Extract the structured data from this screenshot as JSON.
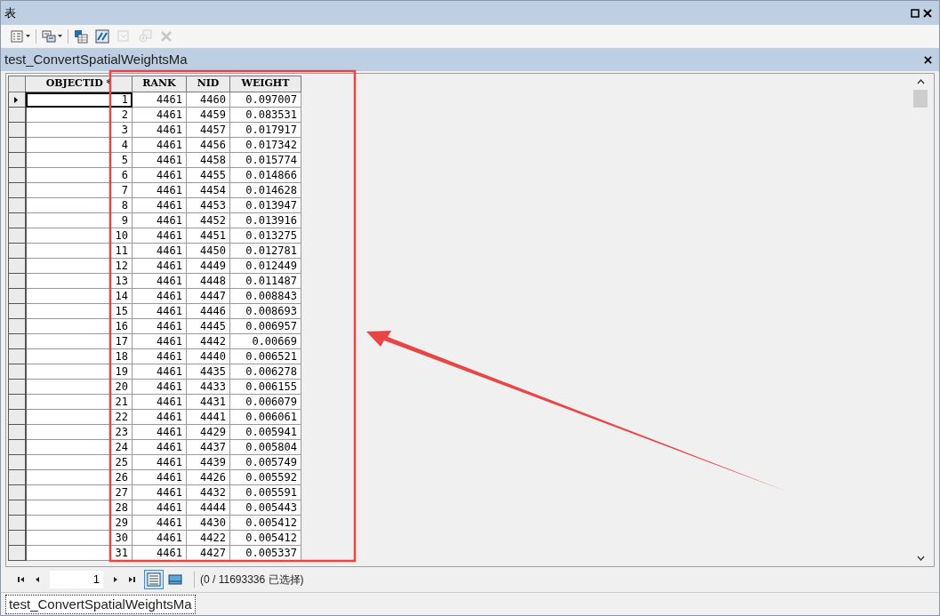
{
  "window": {
    "title": "表"
  },
  "toolbar": [
    {
      "kind": "table-options",
      "disabled": false
    },
    {
      "kind": "related-tables",
      "disabled": false
    },
    {
      "kind": "select-by-attributes",
      "disabled": false
    },
    {
      "kind": "switch-selection",
      "disabled": false
    },
    {
      "kind": "clear-selection",
      "disabled": true
    },
    {
      "kind": "zoom-selected",
      "disabled": true
    },
    {
      "kind": "delete",
      "disabled": true
    }
  ],
  "table_tab": {
    "title": "test_ConvertSpatialWeightsMa"
  },
  "table": {
    "columns": [
      "OBJECTID *",
      "RANK",
      "NID",
      "WEIGHT"
    ],
    "rows": [
      {
        "current": true,
        "cells": [
          "1",
          "4461",
          "4460",
          "0.097007"
        ]
      },
      {
        "current": false,
        "cells": [
          "2",
          "4461",
          "4459",
          "0.083531"
        ]
      },
      {
        "current": false,
        "cells": [
          "3",
          "4461",
          "4457",
          "0.017917"
        ]
      },
      {
        "current": false,
        "cells": [
          "4",
          "4461",
          "4456",
          "0.017342"
        ]
      },
      {
        "current": false,
        "cells": [
          "5",
          "4461",
          "4458",
          "0.015774"
        ]
      },
      {
        "current": false,
        "cells": [
          "6",
          "4461",
          "4455",
          "0.014866"
        ]
      },
      {
        "current": false,
        "cells": [
          "7",
          "4461",
          "4454",
          "0.014628"
        ]
      },
      {
        "current": false,
        "cells": [
          "8",
          "4461",
          "4453",
          "0.013947"
        ]
      },
      {
        "current": false,
        "cells": [
          "9",
          "4461",
          "4452",
          "0.013916"
        ]
      },
      {
        "current": false,
        "cells": [
          "10",
          "4461",
          "4451",
          "0.013275"
        ]
      },
      {
        "current": false,
        "cells": [
          "11",
          "4461",
          "4450",
          "0.012781"
        ]
      },
      {
        "current": false,
        "cells": [
          "12",
          "4461",
          "4449",
          "0.012449"
        ]
      },
      {
        "current": false,
        "cells": [
          "13",
          "4461",
          "4448",
          "0.011487"
        ]
      },
      {
        "current": false,
        "cells": [
          "14",
          "4461",
          "4447",
          "0.008843"
        ]
      },
      {
        "current": false,
        "cells": [
          "15",
          "4461",
          "4446",
          "0.008693"
        ]
      },
      {
        "current": false,
        "cells": [
          "16",
          "4461",
          "4445",
          "0.006957"
        ]
      },
      {
        "current": false,
        "cells": [
          "17",
          "4461",
          "4442",
          "0.00669"
        ]
      },
      {
        "current": false,
        "cells": [
          "18",
          "4461",
          "4440",
          "0.006521"
        ]
      },
      {
        "current": false,
        "cells": [
          "19",
          "4461",
          "4435",
          "0.006278"
        ]
      },
      {
        "current": false,
        "cells": [
          "20",
          "4461",
          "4433",
          "0.006155"
        ]
      },
      {
        "current": false,
        "cells": [
          "21",
          "4461",
          "4431",
          "0.006079"
        ]
      },
      {
        "current": false,
        "cells": [
          "22",
          "4461",
          "4441",
          "0.006061"
        ]
      },
      {
        "current": false,
        "cells": [
          "23",
          "4461",
          "4429",
          "0.005941"
        ]
      },
      {
        "current": false,
        "cells": [
          "24",
          "4461",
          "4437",
          "0.005804"
        ]
      },
      {
        "current": false,
        "cells": [
          "25",
          "4461",
          "4439",
          "0.005749"
        ]
      },
      {
        "current": false,
        "cells": [
          "26",
          "4461",
          "4426",
          "0.005592"
        ]
      },
      {
        "current": false,
        "cells": [
          "27",
          "4461",
          "4432",
          "0.005591"
        ]
      },
      {
        "current": false,
        "cells": [
          "28",
          "4461",
          "4444",
          "0.005443"
        ]
      },
      {
        "current": false,
        "cells": [
          "29",
          "4461",
          "4430",
          "0.005412"
        ]
      },
      {
        "current": false,
        "cells": [
          "30",
          "4461",
          "4422",
          "0.005412"
        ]
      },
      {
        "current": false,
        "cells": [
          "31",
          "4461",
          "4427",
          "0.005337"
        ]
      }
    ]
  },
  "navigation": {
    "page": "1",
    "views": [
      {
        "kind": "all-records",
        "selected": true
      },
      {
        "kind": "selected-records",
        "selected": false
      }
    ],
    "selection_count": "(0 / 11693336 已选择)"
  },
  "bottom_tabs": [
    {
      "label": "test_ConvertSpatialWeightsMa",
      "selected": true
    }
  ]
}
